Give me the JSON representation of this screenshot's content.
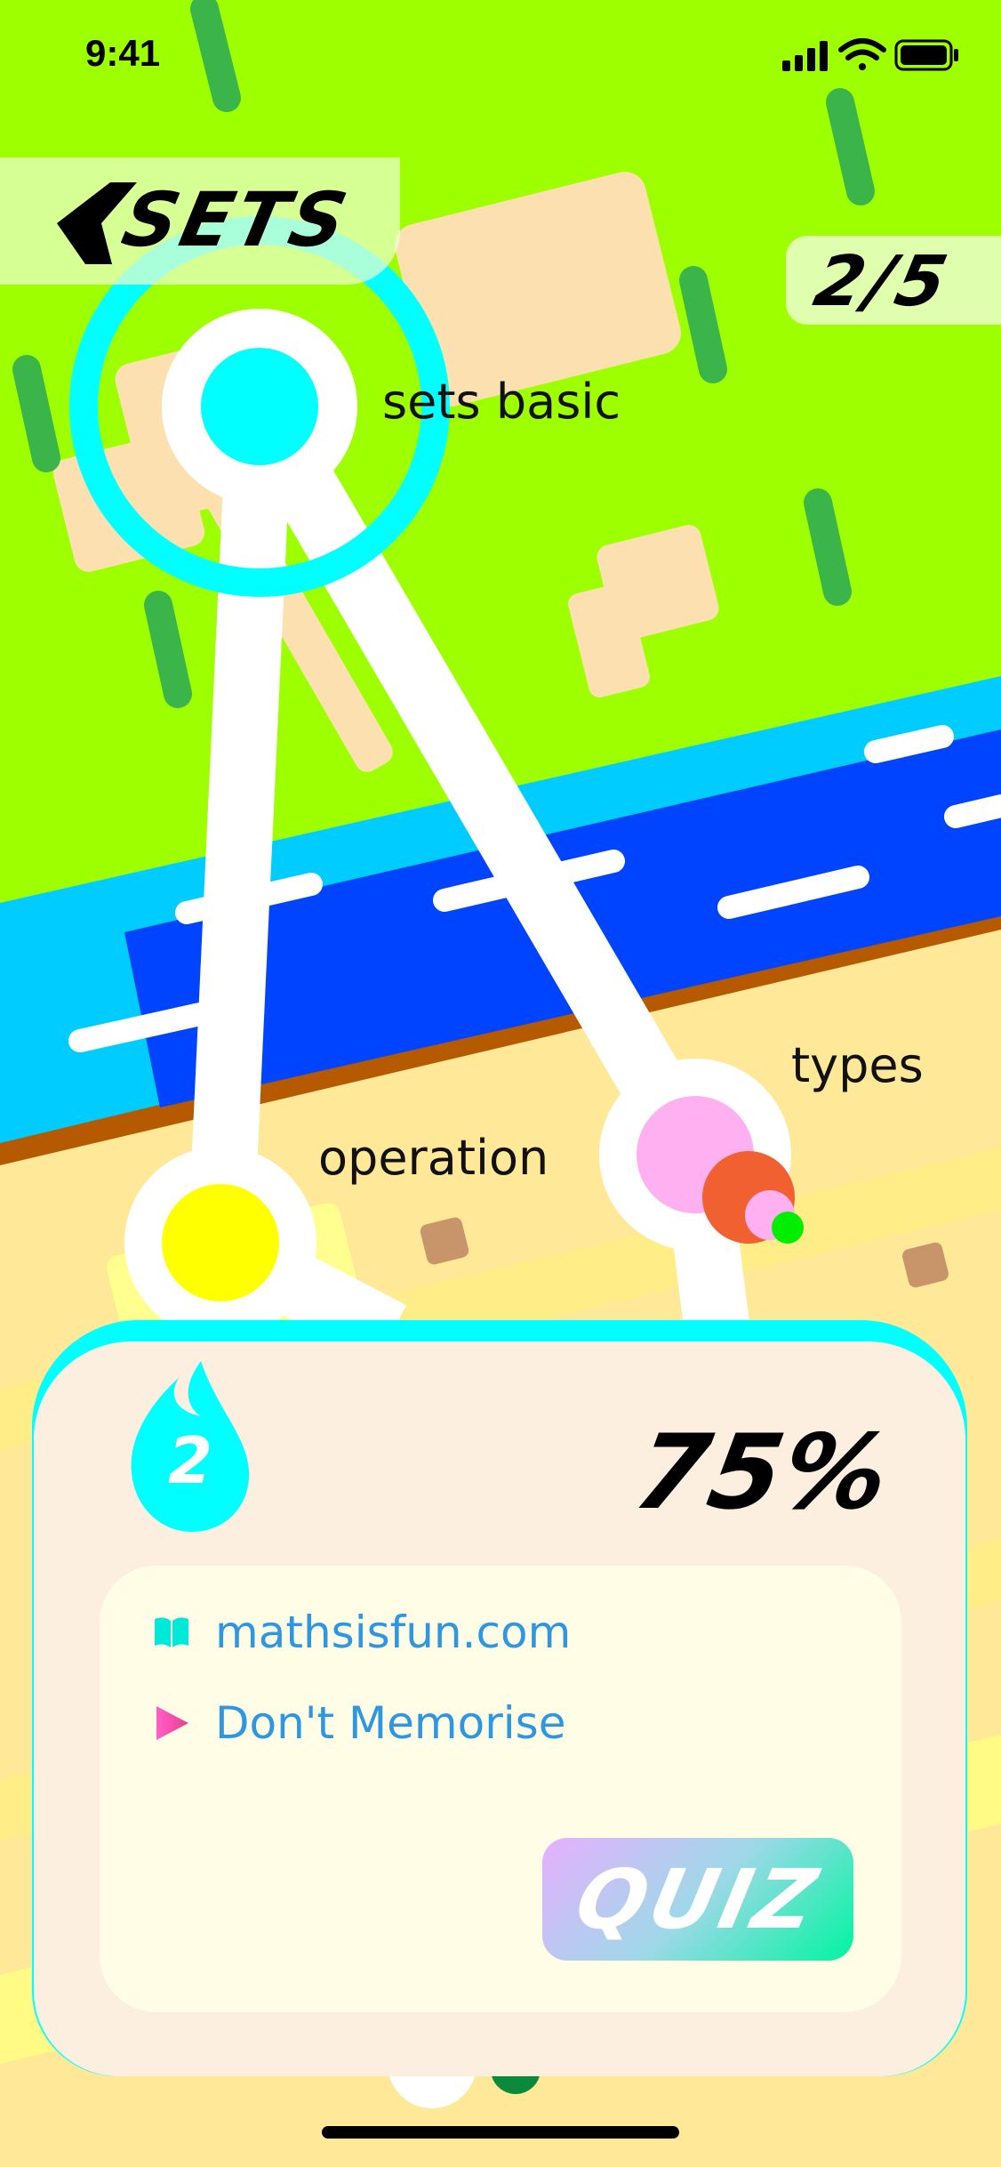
{
  "status_bar": {
    "time": "9:41",
    "icons": [
      "signal-icon",
      "wifi-icon",
      "battery-icon"
    ]
  },
  "header": {
    "back_label": "SETS",
    "progress": "2/5"
  },
  "map": {
    "nodes": [
      {
        "label": "sets basic",
        "color": "#00ffff",
        "state": "current"
      },
      {
        "label": "types",
        "color": "#ffb0f0",
        "state": "unlocked"
      },
      {
        "label": "operation",
        "color": "#ffff00",
        "state": "unlocked"
      }
    ]
  },
  "card": {
    "streak": "2",
    "percent": "75%",
    "resources": [
      {
        "label": "mathsisfun.com",
        "icon": "book-icon"
      },
      {
        "label": "Don't Memorise",
        "icon": "play-icon"
      }
    ],
    "quiz_label": "QUIZ"
  },
  "colors": {
    "grass": "#9dff00",
    "river": "#0044ff",
    "river_edge": "#00ccff",
    "sand": "#ffe898",
    "accent": "#00ffff",
    "card_bg": "#fcefe0",
    "link": "#2e97e0"
  }
}
